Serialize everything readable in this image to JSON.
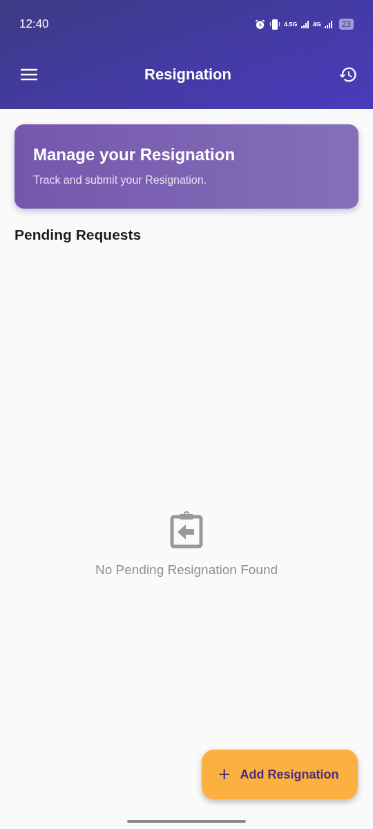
{
  "status_bar": {
    "time": "12:40",
    "network_1": "4.5G",
    "network_2": "4G",
    "battery": "23"
  },
  "app_bar": {
    "title": "Resignation"
  },
  "banner": {
    "title": "Manage your Resignation",
    "subtitle": "Track and submit your Resignation."
  },
  "section": {
    "title": "Pending Requests"
  },
  "empty_state": {
    "message": "No Pending Resignation Found"
  },
  "fab": {
    "icon": "+",
    "label": "Add Resignation"
  }
}
